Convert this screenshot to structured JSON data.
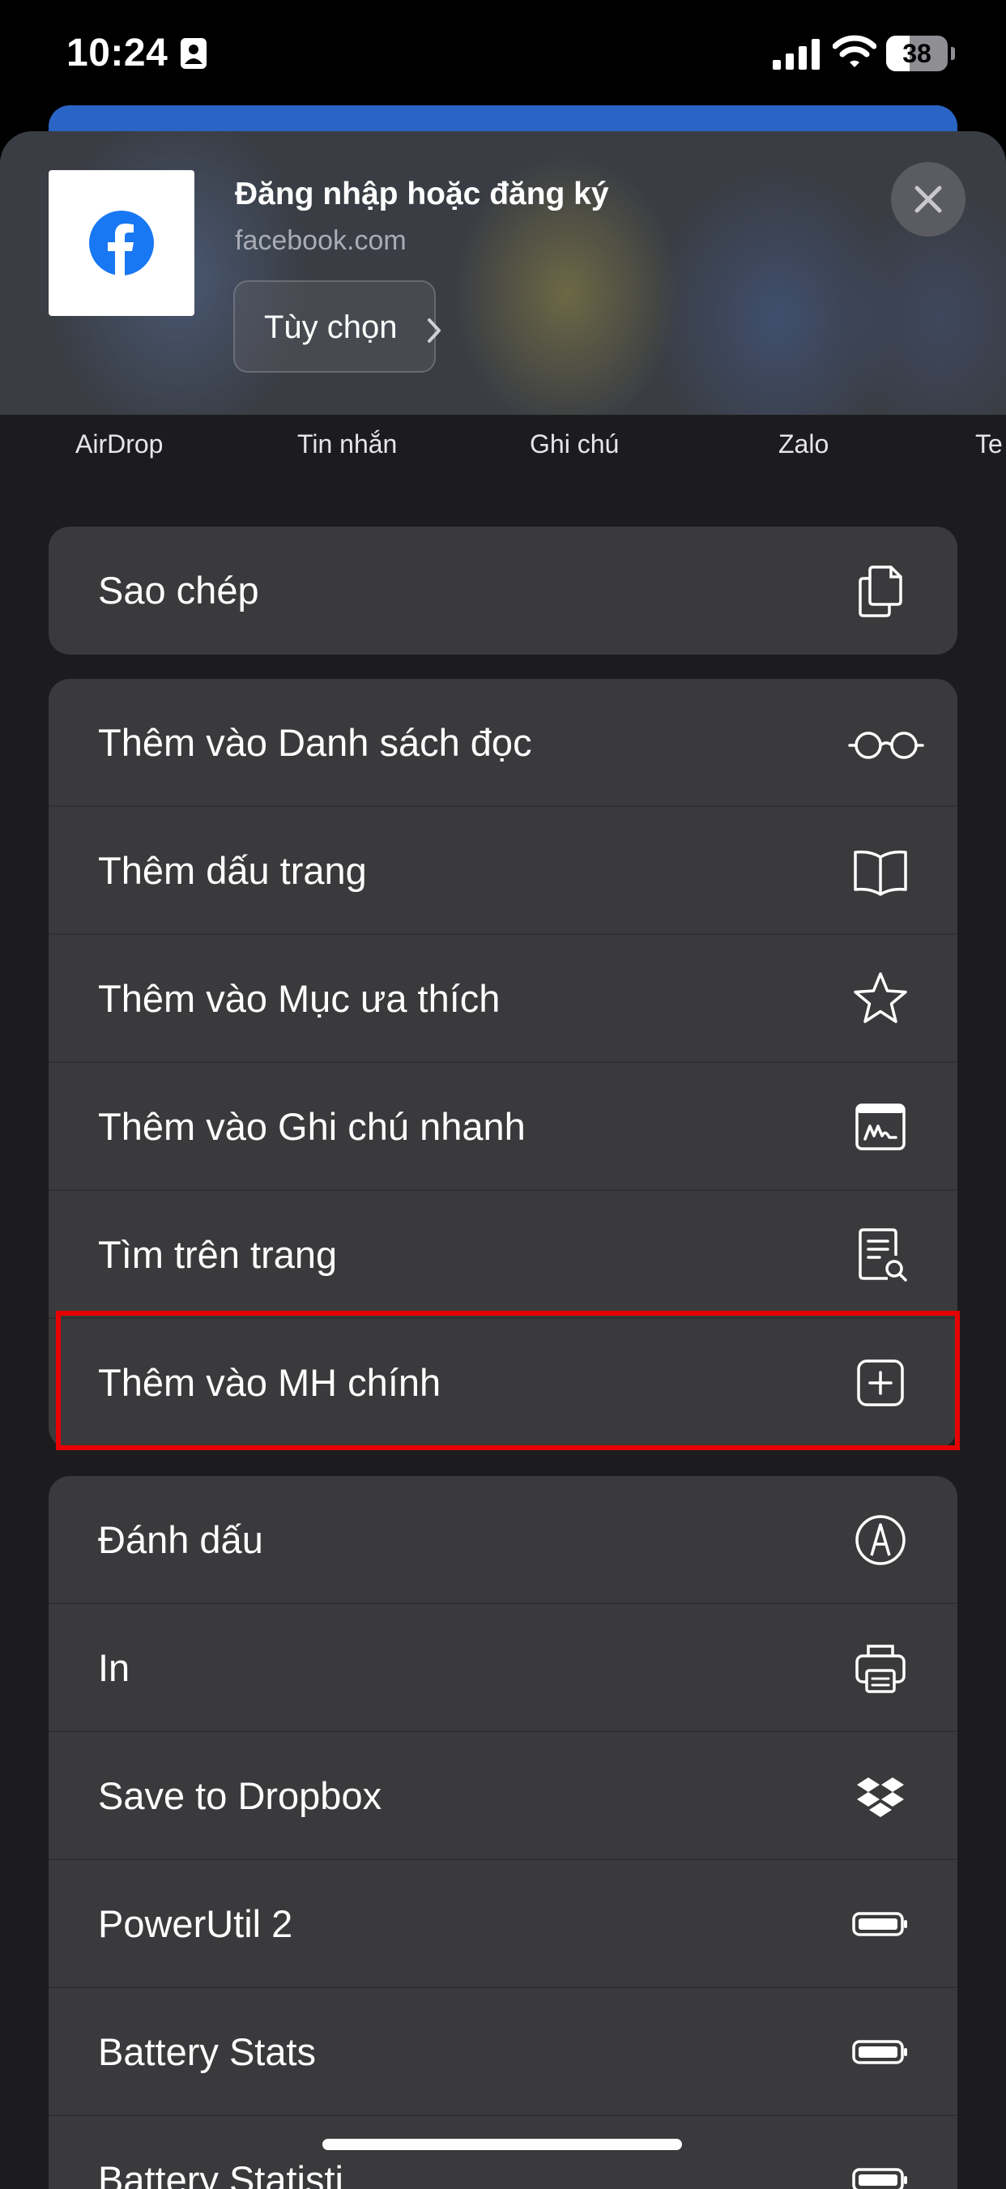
{
  "status_bar": {
    "time": "10:24",
    "battery": "38",
    "battery_level": 0.38
  },
  "header": {
    "page_title": "Đăng nhập hoặc đăng ký",
    "url": "facebook.com",
    "options_label": "Tùy chọn"
  },
  "share_apps": [
    {
      "label": "AirDrop"
    },
    {
      "label": "Tin nhắn"
    },
    {
      "label": "Ghi chú"
    },
    {
      "label": "Zalo"
    },
    {
      "label": "Te"
    }
  ],
  "actions": {
    "group1": [
      {
        "label": "Sao chép",
        "icon": "copy-icon"
      }
    ],
    "group2": [
      {
        "label": "Thêm vào Danh sách đọc",
        "icon": "glasses-icon"
      },
      {
        "label": "Thêm dấu trang",
        "icon": "book-icon"
      },
      {
        "label": "Thêm vào Mục ưa thích",
        "icon": "star-icon"
      },
      {
        "label": "Thêm vào Ghi chú nhanh",
        "icon": "quick-note-icon"
      },
      {
        "label": "Tìm trên trang",
        "icon": "find-page-icon"
      },
      {
        "label": "Thêm vào MH chính",
        "icon": "add-square-icon"
      }
    ],
    "group3": [
      {
        "label": "Đánh dấu",
        "icon": "markup-icon"
      },
      {
        "label": "In",
        "icon": "printer-icon"
      },
      {
        "label": "Save to Dropbox",
        "icon": "dropbox-icon"
      },
      {
        "label": "PowerUtil 2",
        "icon": "battery-icon"
      },
      {
        "label": "Battery Stats",
        "icon": "battery-icon"
      },
      {
        "label": "Battery Statisti",
        "icon": "battery-icon"
      }
    ]
  },
  "colors": {
    "sheet_bg": "#1c1c1e",
    "row_bg": "#3a3a3c",
    "highlight": "#e60000",
    "facebook_blue": "#1877f2"
  }
}
